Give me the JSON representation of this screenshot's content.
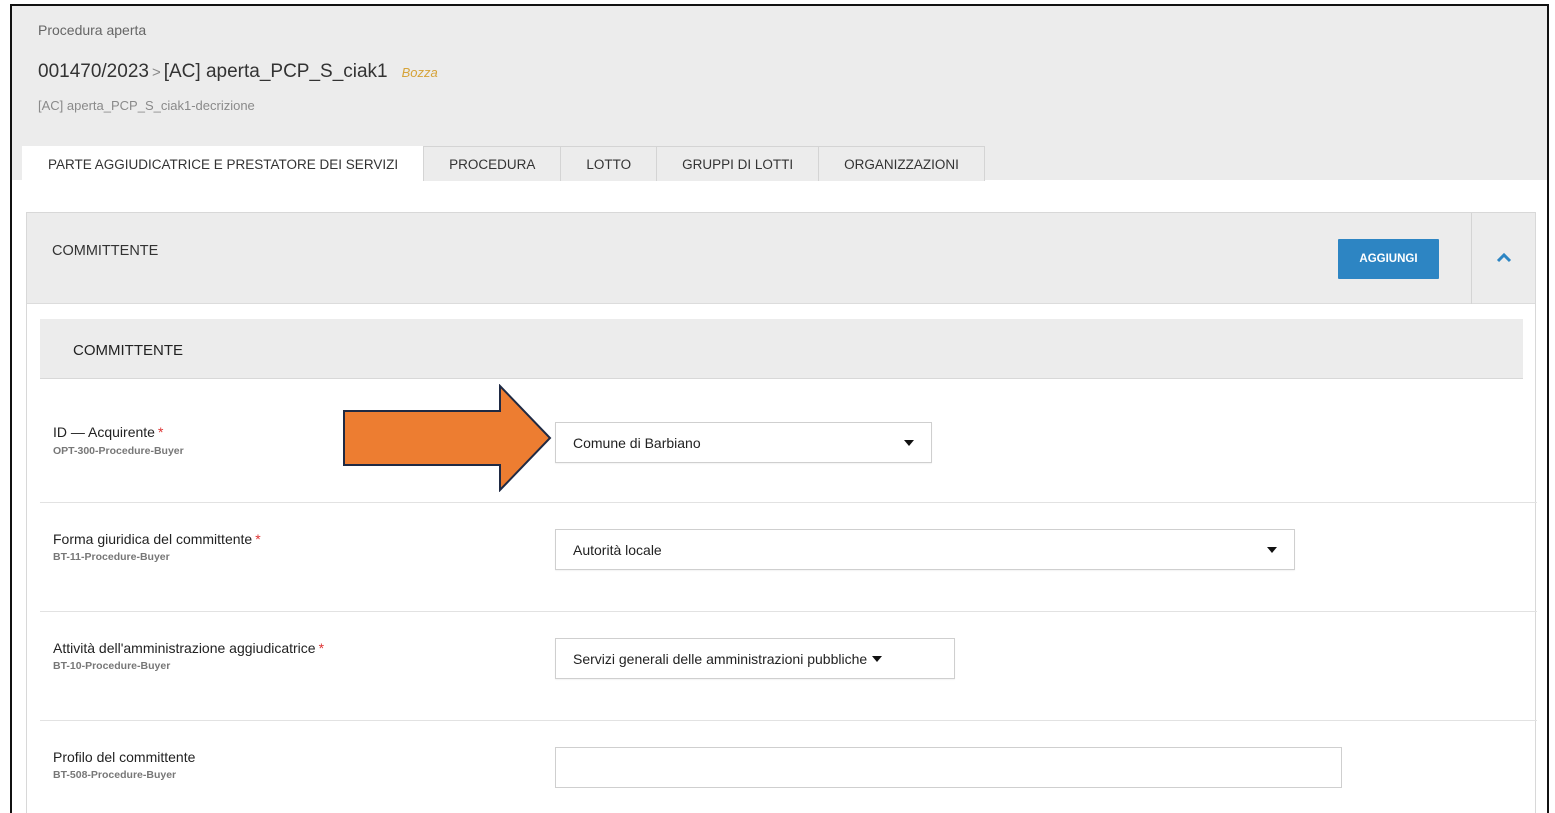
{
  "header": {
    "procedure_type": "Procedura aperta",
    "procedure_number": "001470/2023",
    "separator": ">",
    "procedure_name": "[AC] aperta_PCP_S_ciak1",
    "status": "Bozza",
    "description": "[AC] aperta_PCP_S_ciak1-decrizione"
  },
  "tabs": [
    {
      "label": "PARTE AGGIUDICATRICE E PRESTATORE DEI SERVIZI",
      "active": true
    },
    {
      "label": "PROCEDURA",
      "active": false
    },
    {
      "label": "LOTTO",
      "active": false
    },
    {
      "label": "GRUPPI DI LOTTI",
      "active": false
    },
    {
      "label": "ORGANIZZAZIONI",
      "active": false
    }
  ],
  "panel": {
    "title": "COMMITTENTE",
    "add_label": "AGGIUNGI",
    "collapse_icon": "chevron-up-icon",
    "accent_color": "#2d85c3"
  },
  "section": {
    "title": "COMMITTENTE"
  },
  "fields": [
    {
      "label": "ID — Acquirente",
      "required": "*",
      "code": "OPT-300-Procedure-Buyer",
      "value": "Comune di Barbiano"
    },
    {
      "label": "Forma giuridica del committente",
      "required": "*",
      "code": "BT-11-Procedure-Buyer",
      "value": "Autorità locale"
    },
    {
      "label": "Attività dell'amministrazione aggiudicatrice",
      "required": "*",
      "code": "BT-10-Procedure-Buyer",
      "value": "Servizi generali delle amministrazioni pubbliche"
    },
    {
      "label": "Profilo del committente",
      "code": "BT-508-Procedure-Buyer",
      "value": ""
    }
  ],
  "annotation": {
    "icon": "arrow-right-icon",
    "fill_color": "#ed7d31",
    "stroke_color": "#1f2a44"
  }
}
